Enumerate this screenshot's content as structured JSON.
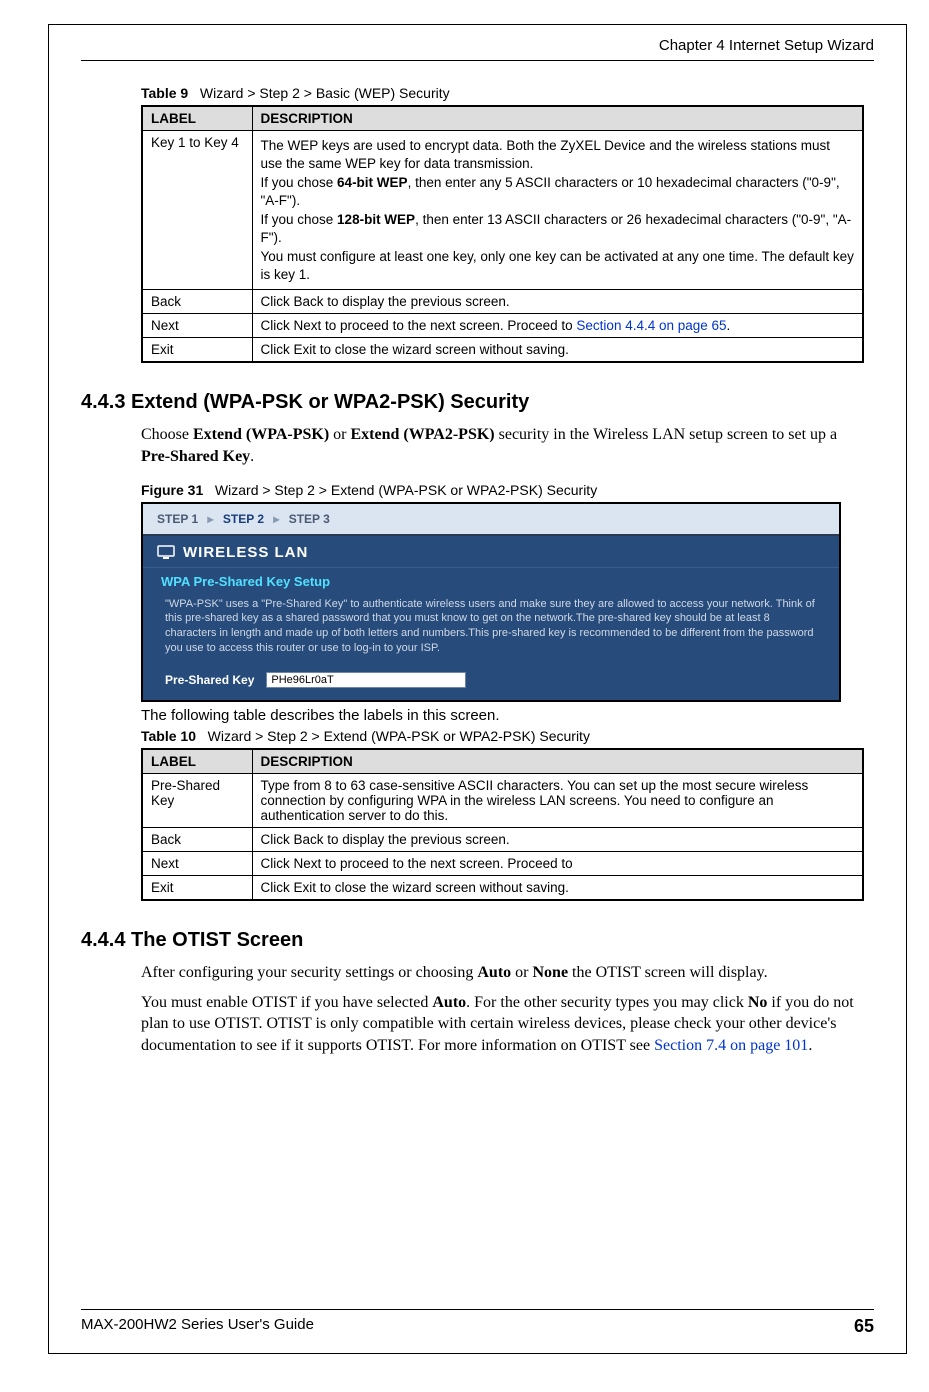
{
  "header": {
    "chapter_line": "Chapter 4 Internet Setup Wizard"
  },
  "table9": {
    "caption_prefix": "Table 9",
    "caption_rest": "Wizard > Step 2 > Basic (WEP) Security",
    "col_label": "LABEL",
    "col_desc": "DESCRIPTION",
    "rows": {
      "key": {
        "label": "Key 1 to Key 4",
        "p1": "The WEP keys are used to encrypt data. Both the ZyXEL Device and the wireless stations must use the same WEP key for data transmission.",
        "p2a": "If you chose ",
        "p2b_bold": "64-bit WEP",
        "p2c": ", then enter any 5 ASCII characters or 10 hexadecimal characters (\"0-9\", \"A-F\").",
        "p3a": "If you chose ",
        "p3b_bold": "128-bit WEP",
        "p3c": ", then enter 13 ASCII characters or 26 hexadecimal characters   (\"0-9\", \"A-F\").",
        "p4": "You must configure at least one key, only one key can be activated at any one time. The default key is key 1."
      },
      "back": {
        "label": "Back",
        "a": "Click ",
        "b_bold": "Back",
        "c": " to display the previous screen."
      },
      "next": {
        "label": "Next",
        "a": "Click ",
        "b_bold": "Next",
        "c": " to proceed to the next screen. Proceed to ",
        "link": "Section 4.4.4 on page 65",
        "d": "."
      },
      "exit": {
        "label": "Exit",
        "a": "Click ",
        "b_bold": "Exit",
        "c": " to close the wizard screen without saving."
      }
    }
  },
  "section443": {
    "heading": "4.4.3  Extend (WPA-PSK or WPA2-PSK) Security",
    "p1_a": "Choose ",
    "p1_b_bold": "Extend (WPA-PSK)",
    "p1_c": " or ",
    "p1_d_bold": "Extend (WPA2-PSK)",
    "p1_e": " security in the Wireless LAN setup screen to set up a ",
    "p1_f_bold": "Pre-Shared Key",
    "p1_g": "."
  },
  "figure31": {
    "caption_prefix": "Figure 31",
    "caption_rest": "Wizard > Step 2 > Extend (WPA-PSK or WPA2-PSK) Security",
    "step1": "STEP 1",
    "step2": "STEP 2",
    "step3": "STEP 3",
    "title": "WIRELESS LAN",
    "subtitle": "WPA Pre-Shared Key Setup",
    "body": "\"WPA-PSK\" uses a \"Pre-Shared Key\" to authenticate wireless users and make sure they are allowed to access your network. Think of this pre-shared key as a shared password that you must know to get on the network.The pre-shared key should be at least 8 characters in length and made up of both letters and numbers.This pre-shared key is recommended to be different from the password you use to access this router or use to log-in to your ISP.",
    "psk_label": "Pre-Shared Key",
    "psk_value": "PHe96Lr0aT"
  },
  "table10": {
    "intro": "The following table describes the labels in this screen.",
    "caption_prefix": "Table 10",
    "caption_rest": "Wizard > Step 2 > Extend (WPA-PSK or WPA2-PSK) Security",
    "col_label": "LABEL",
    "col_desc": "DESCRIPTION",
    "rows": {
      "psk": {
        "label": "Pre-Shared Key",
        "desc": "Type from 8 to 63 case-sensitive ASCII characters. You can set up the most secure wireless connection by configuring WPA in the wireless LAN screens. You need to configure an authentication server to do this."
      },
      "back": {
        "label": "Back",
        "a": "Click ",
        "b_bold": "Back",
        "c": " to display the previous screen."
      },
      "next": {
        "label": "Next",
        "a": "Click ",
        "b_bold": "Next",
        "c": " to proceed to the next screen. Proceed to"
      },
      "exit": {
        "label": "Exit",
        "a": "Click ",
        "b_bold": "Exit",
        "c": " to close the wizard screen without saving."
      }
    }
  },
  "section444": {
    "heading": "4.4.4  The OTIST Screen",
    "p1_a": "After configuring your security settings or choosing ",
    "p1_b_bold": "Auto",
    "p1_c": " or ",
    "p1_d_bold": "None",
    "p1_e": " the OTIST screen will display.",
    "p2_a": "You must enable OTIST if you have selected ",
    "p2_b_bold": "Auto",
    "p2_c": ". For the other security types you may click ",
    "p2_d_bold": "No",
    "p2_e": " if you do not plan to use OTIST. OTIST is only compatible with certain wireless devices, please check your other device's documentation to see if it supports OTIST. For more information on OTIST see ",
    "p2_link": "Section 7.4 on page 101",
    "p2_f": "."
  },
  "footer": {
    "guide": "MAX-200HW2 Series User's Guide",
    "page": "65"
  }
}
